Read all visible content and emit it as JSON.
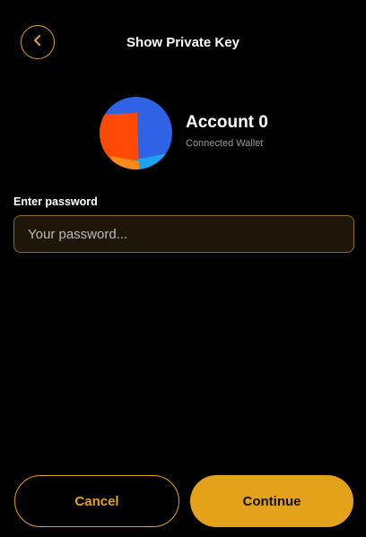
{
  "header": {
    "title": "Show Private Key",
    "back_icon": "chevron-left-icon"
  },
  "account": {
    "name": "Account 0",
    "subtitle": "Connected Wallet"
  },
  "password": {
    "label": "Enter password",
    "placeholder": "Your password...",
    "value": ""
  },
  "actions": {
    "cancel_label": "Cancel",
    "continue_label": "Continue"
  },
  "colors": {
    "accent": "#e3a21a",
    "background": "#000000",
    "input_background": "#1e1608"
  }
}
